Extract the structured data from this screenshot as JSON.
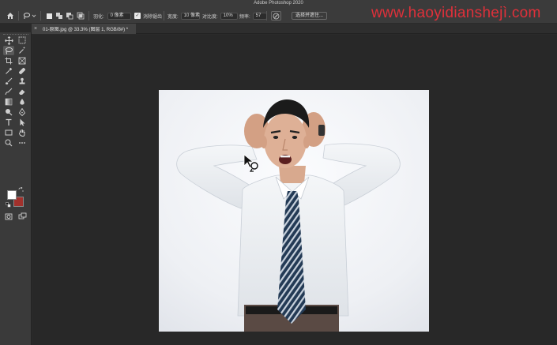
{
  "app": {
    "title": "Adobe Photoshop 2020"
  },
  "watermark": "www.haoyidianshejì.com",
  "options_bar": {
    "feather_label": "羽化:",
    "feather_value": "0 像素",
    "antialias_label": "消除锯齿",
    "antialias_checked": true,
    "width_label": "宽度:",
    "width_value": "10 像素",
    "contrast_label": "对比度:",
    "contrast_value": "10%",
    "frequency_label": "频率:",
    "frequency_value": "57",
    "select_mask_label": "选择并遮住..."
  },
  "document_tab": {
    "title": "01-原图.jpg @ 33.3% (图层 1, RGB/8#) *"
  },
  "toolbar": {
    "tools": [
      "move-tool",
      "marquee-tool",
      "magnetic-lasso-tool",
      "magic-wand-tool",
      "crop-tool",
      "frame-tool",
      "eyedropper-tool",
      "healing-brush-tool",
      "brush-tool",
      "clone-stamp-tool",
      "history-brush-tool",
      "eraser-tool",
      "gradient-tool",
      "blur-tool",
      "dodge-tool",
      "pen-tool",
      "type-tool",
      "path-selection-tool",
      "rectangle-tool",
      "hand-tool",
      "zoom-tool",
      "more-tools"
    ],
    "foreground_color": "#ffffff",
    "background_color": "#a2312c"
  },
  "colors": {
    "accent_watermark": "#e0303a",
    "canvas_bg": "#282828",
    "panel_bg": "#3a3a3a"
  }
}
